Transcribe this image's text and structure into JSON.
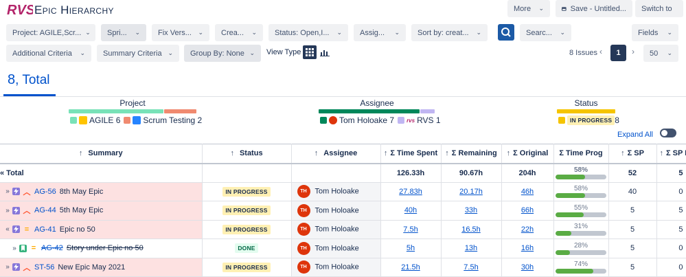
{
  "app": {
    "title": "Epic Hierarchy",
    "logo_text": "RVS"
  },
  "top_buttons": {
    "more": "More",
    "save": "Save - Untitled...",
    "switch": "Switch to"
  },
  "filters_row1": [
    {
      "label": "Project: AGILE,Scr..."
    },
    {
      "label": "Spri..."
    },
    {
      "label": "Fix Vers..."
    },
    {
      "label": "Crea..."
    },
    {
      "label": "Status: Open,I..."
    },
    {
      "label": "Assig..."
    },
    {
      "label": "Sort by: creat..."
    },
    {
      "label": "Searc..."
    },
    {
      "label": "Fields"
    }
  ],
  "filters_row2": [
    {
      "label": "Additional Criteria"
    },
    {
      "label": "Summary Criteria"
    },
    {
      "label": "Group By: None"
    }
  ],
  "view_type_label": "View Type",
  "pagination": {
    "issues": "8 Issues",
    "page": "1",
    "per_page": "50"
  },
  "total_heading": {
    "count": "8",
    "label": "Total"
  },
  "groups": {
    "project": {
      "title": "Project",
      "items": [
        {
          "label": "AGILE",
          "count": "6",
          "color": "#79e2b8"
        },
        {
          "label": "Scrum Testing",
          "count": "2",
          "color": "#f08a70"
        }
      ]
    },
    "assignee": {
      "title": "Assignee",
      "items": [
        {
          "label": "Tom Holoake",
          "count": "7",
          "color": "#00875a"
        },
        {
          "label": "RVS",
          "count": "1",
          "color": "#c0b6f2"
        }
      ]
    },
    "status": {
      "title": "Status",
      "items": [
        {
          "label": "IN PROGRESS",
          "count": "8",
          "color": "#f5c400"
        }
      ]
    }
  },
  "expand_all": "Expand All",
  "table": {
    "headers": [
      "Summary",
      "Status",
      "Assignee",
      "Σ Time Spent",
      "Σ Remaining",
      "Σ Original",
      "Σ Time Prog",
      "Σ SP",
      "Σ SP D"
    ],
    "total_row": {
      "label": "« Total",
      "time_spent": "126.33h",
      "remaining": "90.67h",
      "original": "204h",
      "progress_text": "58%",
      "progress": 58,
      "sp": "52",
      "sp_d": "5"
    },
    "rows": [
      {
        "expander": "»",
        "key": "AG-56",
        "title": "8th May Epic",
        "status": "IN PROGRESS",
        "assignee": "Tom Holoake",
        "initials": "TH",
        "time_spent": "27.83h",
        "remaining": "20.17h",
        "original": "46h",
        "progress_text": "58%",
        "progress": 58,
        "sp": "40",
        "sp_d": "0"
      },
      {
        "expander": "»",
        "key": "AG-44",
        "title": "5th May Epic",
        "status": "IN PROGRESS",
        "assignee": "Tom Holoake",
        "initials": "TH",
        "time_spent": "40h",
        "remaining": "33h",
        "original": "66h",
        "progress_text": "55%",
        "progress": 55,
        "sp": "5",
        "sp_d": "5"
      },
      {
        "expander": "«",
        "key": "AG-41",
        "title": "Epic no 50",
        "status": "IN PROGRESS",
        "assignee": "Tom Holoake",
        "initials": "TH",
        "time_spent": "7.5h",
        "remaining": "16.5h",
        "original": "22h",
        "progress_text": "31%",
        "progress": 31,
        "sp": "5",
        "sp_d": "5"
      },
      {
        "expander": "»",
        "key": "AG-42",
        "title": "Story under Epic no 50",
        "status": "DONE",
        "assignee": "Tom Holoake",
        "initials": "TH",
        "time_spent": "5h",
        "remaining": "13h",
        "original": "16h",
        "progress_text": "28%",
        "progress": 28,
        "sp": "5",
        "sp_d": "0"
      },
      {
        "expander": "»",
        "key": "ST-56",
        "title": "New Epic May 2021",
        "status": "IN PROGRESS",
        "assignee": "Tom Holoake",
        "initials": "TH",
        "time_spent": "21.5h",
        "remaining": "7.5h",
        "original": "30h",
        "progress_text": "74%",
        "progress": 74,
        "sp": "5",
        "sp_d": "0"
      }
    ]
  },
  "colors": {
    "accent": "#0052cc",
    "epic_row": "#fde1e1",
    "epic_icon": "#8777d9",
    "story_icon": "#36b37e",
    "progress_bar": "#5aac44",
    "priority_high": "#ff5630",
    "priority_medium": "#ffab00"
  }
}
